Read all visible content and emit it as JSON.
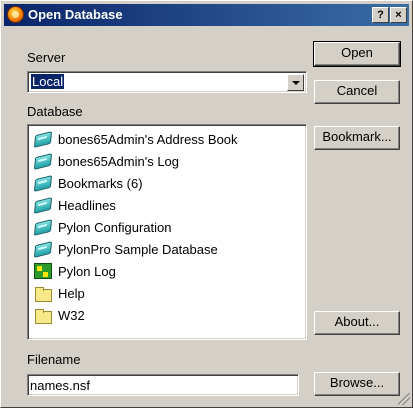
{
  "window": {
    "title": "Open Database",
    "help_button": "?",
    "close_button": "×"
  },
  "server": {
    "label": "Server",
    "value": "Local"
  },
  "database": {
    "label": "Database",
    "items": [
      {
        "label": "bones65Admin's Address Book",
        "icon": "database-icon"
      },
      {
        "label": "bones65Admin's Log",
        "icon": "database-icon"
      },
      {
        "label": "Bookmarks (6)",
        "icon": "database-icon"
      },
      {
        "label": "Headlines",
        "icon": "database-icon"
      },
      {
        "label": "Pylon Configuration",
        "icon": "database-icon"
      },
      {
        "label": "PylonPro Sample Database",
        "icon": "database-icon"
      },
      {
        "label": "Pylon Log",
        "icon": "log-database-icon"
      },
      {
        "label": "Help",
        "icon": "folder-icon"
      },
      {
        "label": "W32",
        "icon": "folder-icon"
      }
    ]
  },
  "filename": {
    "label": "Filename",
    "value": "names.nsf"
  },
  "buttons": {
    "open": "Open",
    "cancel": "Cancel",
    "bookmark": "Bookmark...",
    "about": "About...",
    "browse": "Browse..."
  },
  "colors": {
    "titlebar": "#0a246a",
    "dialog_bg": "#d4d0c8",
    "selection": "#0a246a"
  }
}
